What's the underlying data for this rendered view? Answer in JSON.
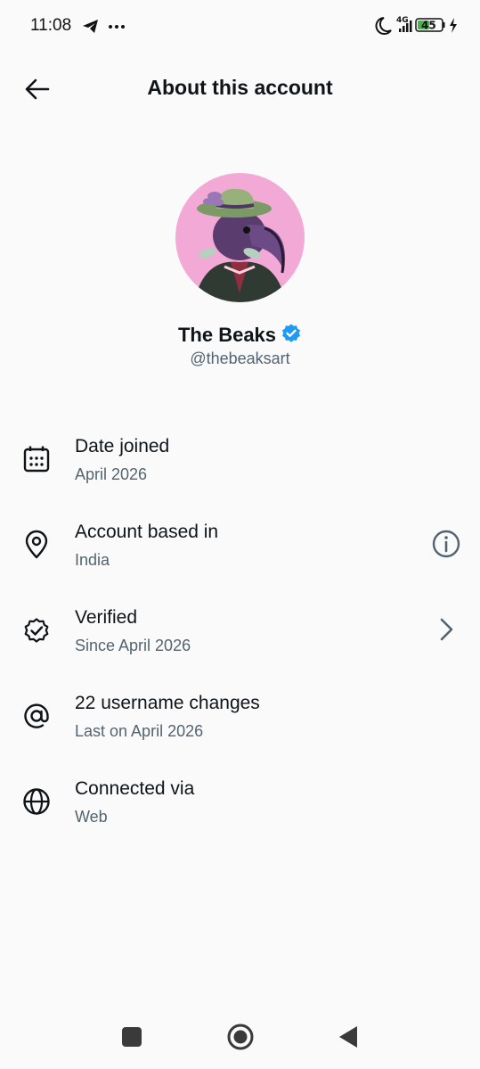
{
  "status_bar": {
    "time": "11:08",
    "network": "4G",
    "battery": "45",
    "icons": [
      "telegram-icon",
      "more-dots-icon",
      "moon-icon",
      "signal-icon",
      "battery-icon",
      "charging-icon"
    ]
  },
  "header": {
    "title": "About this account",
    "back_icon": "back-arrow-icon"
  },
  "profile": {
    "name": "The Beaks",
    "handle": "@thebeaksart",
    "verified": true,
    "badge_color": "#1d9bf0",
    "avatar_bg": "#f3a9d5"
  },
  "items": [
    {
      "icon": "calendar-icon",
      "title": "Date joined",
      "subtitle": "April 2026"
    },
    {
      "icon": "location-pin-icon",
      "title": "Account based in",
      "subtitle": "India",
      "trailing": "info-icon"
    },
    {
      "icon": "verified-check-icon",
      "title": "Verified",
      "subtitle": "Since April 2026",
      "trailing": "chevron-right-icon"
    },
    {
      "icon": "at-sign-icon",
      "title": "22 username changes",
      "subtitle": "Last on April 2026"
    },
    {
      "icon": "globe-icon",
      "title": "Connected via",
      "subtitle": "Web"
    }
  ],
  "nav": [
    "recents-square-icon",
    "home-circle-icon",
    "back-triangle-icon"
  ]
}
